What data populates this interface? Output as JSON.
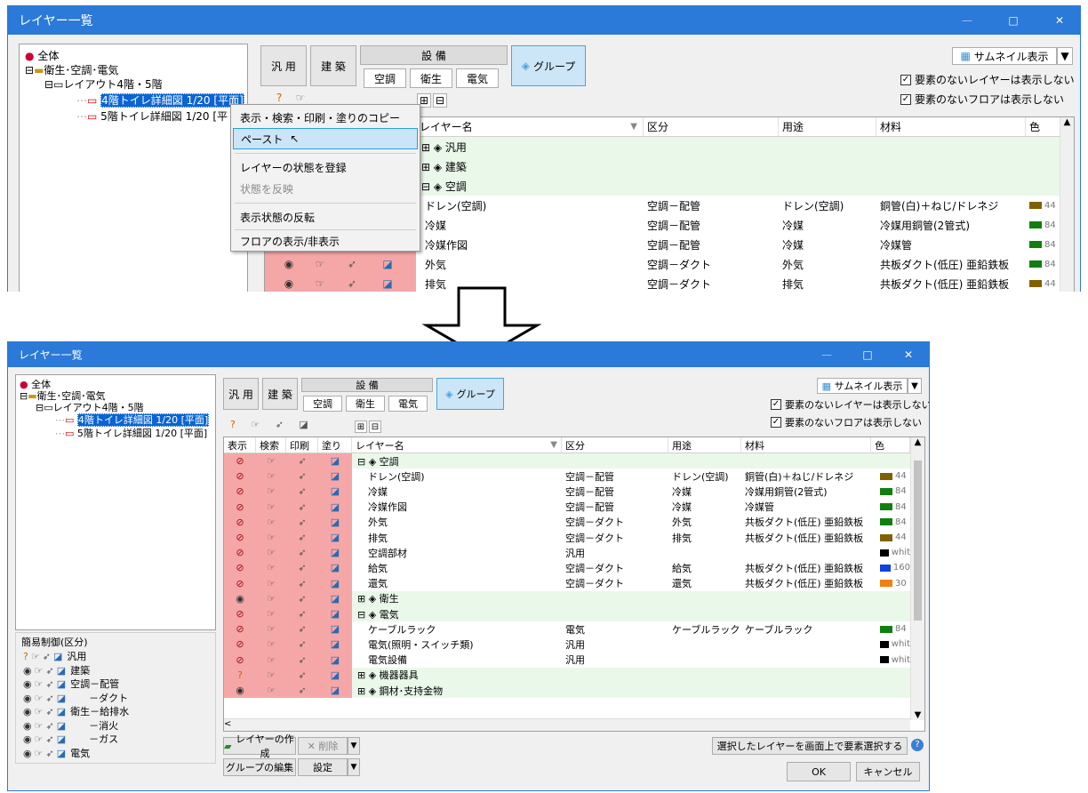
{
  "window_title": "レイヤー一覧",
  "title_buttons": {
    "minimize": "—",
    "maximize": "□",
    "close": "✕"
  },
  "tree": {
    "root": "全体",
    "n1": "衛生･空調･電気",
    "n2": "レイアウト4階・5階",
    "n3": "4階トイレ詳細図 1/20 [平面]",
    "n4": "5階トイレ詳細図 1/20 [平面]",
    "n3_cut": "4階トイレ詳細図 1/20 [平面]",
    "n4_cut": "5階トイレ詳細図 1/20 [平"
  },
  "tabs": {
    "general": "汎 用",
    "arch": "建 築",
    "equip": "設 備",
    "aircon": "空調",
    "sanitary": "衛生",
    "electric": "電気",
    "group": "グループ"
  },
  "top_right": {
    "thumbnail": "サムネイル表示",
    "chk1": "要素のないレイヤーは表示しない",
    "chk2": "要素のないフロアは表示しない"
  },
  "columns": {
    "show": "表示",
    "search": "検索",
    "print": "印刷",
    "fill": "塗り",
    "name": "レイヤー名",
    "division": "区分",
    "usage": "用途",
    "material": "材料",
    "color": "色"
  },
  "context_menu": [
    "表示・検索・印刷・塗りのコピー",
    "ペースト",
    "レイヤーの状態を登録",
    "状態を反映",
    "表示状態の反転",
    "フロアの表示/非表示"
  ],
  "top_groups": [
    "汎用",
    "建築",
    "空調"
  ],
  "top_rows": [
    {
      "name": "ドレン(空調)",
      "division": "空調－配管",
      "usage": "ドレン(空調)",
      "material": "銅管(白)＋ねじ/ドレネジ",
      "color": "#806000",
      "cnum": "44"
    },
    {
      "name": "冷媒",
      "division": "空調－配管",
      "usage": "冷媒",
      "material": "冷媒用銅管(2管式)",
      "color": "#107f10",
      "cnum": "84"
    },
    {
      "name": "冷媒作図",
      "division": "空調－配管",
      "usage": "冷媒",
      "material": "冷媒管",
      "color": "#107f10",
      "cnum": "84"
    },
    {
      "name": "外気",
      "division": "空調－ダクト",
      "usage": "外気",
      "material": "共板ダクト(低圧) 亜鉛鉄板",
      "color": "#107f10",
      "cnum": "84"
    },
    {
      "name": "排気",
      "division": "空調－ダクト",
      "usage": "排気",
      "material": "共板ダクト(低圧) 亜鉛鉄板",
      "color": "#806000",
      "cnum": "44"
    }
  ],
  "bottom_rows": [
    {
      "type": "group",
      "sign": "⊟",
      "name": "空調"
    },
    {
      "type": "row",
      "name": "ドレン(空調)",
      "division": "空調－配管",
      "usage": "ドレン(空調)",
      "material": "銅管(白)＋ねじ/ドレネジ",
      "color": "#806000",
      "cnum": "44",
      "eye": "off"
    },
    {
      "type": "row",
      "name": "冷媒",
      "division": "空調－配管",
      "usage": "冷媒",
      "material": "冷媒用銅管(2管式)",
      "color": "#107f10",
      "cnum": "84",
      "eye": "off"
    },
    {
      "type": "row",
      "name": "冷媒作図",
      "division": "空調－配管",
      "usage": "冷媒",
      "material": "冷媒管",
      "color": "#107f10",
      "cnum": "84",
      "eye": "off"
    },
    {
      "type": "row",
      "name": "外気",
      "division": "空調－ダクト",
      "usage": "外気",
      "material": "共板ダクト(低圧) 亜鉛鉄板",
      "color": "#107f10",
      "cnum": "84",
      "eye": "off"
    },
    {
      "type": "row",
      "name": "排気",
      "division": "空調－ダクト",
      "usage": "排気",
      "material": "共板ダクト(低圧) 亜鉛鉄板",
      "color": "#806000",
      "cnum": "44",
      "eye": "off"
    },
    {
      "type": "row",
      "name": "空調部材",
      "division": "汎用",
      "usage": "",
      "material": "",
      "color": "#000000",
      "cnum": "whit",
      "eye": "off"
    },
    {
      "type": "row",
      "name": "給気",
      "division": "空調－ダクト",
      "usage": "給気",
      "material": "共板ダクト(低圧) 亜鉛鉄板",
      "color": "#1040e0",
      "cnum": "160",
      "eye": "off"
    },
    {
      "type": "row",
      "name": "還気",
      "division": "空調－ダクト",
      "usage": "還気",
      "material": "共板ダクト(低圧) 亜鉛鉄板",
      "color": "#f08010",
      "cnum": "30",
      "eye": "off"
    },
    {
      "type": "group",
      "sign": "⊞",
      "name": "衛生",
      "eye": "on"
    },
    {
      "type": "group",
      "sign": "⊟",
      "name": "電気"
    },
    {
      "type": "row",
      "name": "ケーブルラック",
      "division": "電気",
      "usage": "ケーブルラック",
      "material": "ケーブルラック",
      "color": "#107f10",
      "cnum": "84",
      "eye": "off"
    },
    {
      "type": "row",
      "name": "電気(照明・スイッチ類)",
      "division": "汎用",
      "usage": "",
      "material": "",
      "color": "#000000",
      "cnum": "whit",
      "eye": "off"
    },
    {
      "type": "row",
      "name": "電気設備",
      "division": "汎用",
      "usage": "",
      "material": "",
      "color": "#000000",
      "cnum": "whit",
      "eye": "off"
    },
    {
      "type": "group",
      "sign": "⊞",
      "name": "機器器具",
      "eye": "q"
    },
    {
      "type": "group",
      "sign": "⊞",
      "name": "鋼材･支持金物",
      "eye": "on"
    }
  ],
  "simple_control": {
    "title": "簡易制御(区分)",
    "items": [
      "汎用",
      "建築",
      "空調－配管",
      "－ダクト",
      "衛生－給排水",
      "－消火",
      "－ガス",
      "電気"
    ]
  },
  "bottom_buttons": {
    "create": "レイヤーの作成",
    "delete": "削除",
    "group_edit": "グループの編集",
    "settings": "設定",
    "select_on_screen": "選択したレイヤーを画面上で要素選択する",
    "ok": "OK",
    "cancel": "キャンセル"
  }
}
